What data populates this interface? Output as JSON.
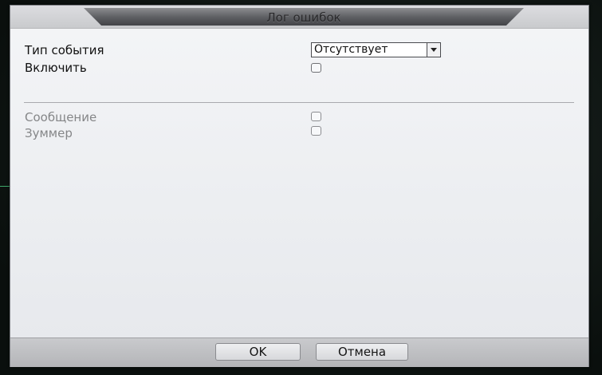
{
  "window": {
    "title": "Лог ошибок"
  },
  "form": {
    "event_type_label": "Тип события",
    "event_type_value": "Отсутствует",
    "enable_label": "Включить",
    "enable_checked": false,
    "message_label": "Сообщение",
    "message_checked": false,
    "buzzer_label": "Зуммер",
    "buzzer_checked": false
  },
  "footer": {
    "ok_label": "OK",
    "cancel_label": "Отмена"
  },
  "colors": {
    "panel_bg": "#eceef1",
    "title_bar": "#5c5d61",
    "disabled_text": "#858688",
    "footer_bg": "#b4b5b8"
  },
  "icons": {
    "select_arrow": "chevron-down-icon"
  }
}
